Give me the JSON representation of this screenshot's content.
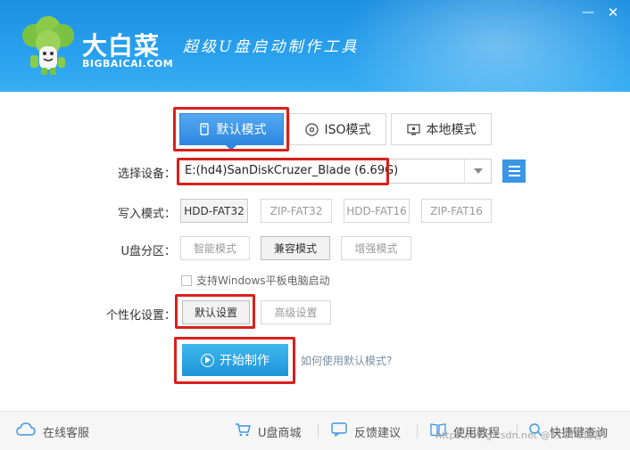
{
  "brand": {
    "name": "大白菜",
    "domain": "BIGBAICAI.COM",
    "slogan": "超级U盘启动制作工具"
  },
  "window": {
    "minimize": "—",
    "close": "✕"
  },
  "tabs": [
    {
      "label": "默认模式",
      "icon": "usb-icon",
      "active": true
    },
    {
      "label": "ISO模式",
      "icon": "disc-icon",
      "active": false
    },
    {
      "label": "本地模式",
      "icon": "monitor-icon",
      "active": false
    }
  ],
  "device": {
    "label": "选择设备：",
    "value": "E:(hd4)SanDiskCruzer_Blade (6.69G)"
  },
  "write_mode": {
    "label": "写入模式：",
    "options": [
      "HDD-FAT32",
      "ZIP-FAT32",
      "HDD-FAT16",
      "ZIP-FAT16"
    ],
    "selected": "HDD-FAT32"
  },
  "partition": {
    "label": "U盘分区：",
    "options": [
      "智能模式",
      "兼容模式",
      "增强模式"
    ],
    "selected": "兼容模式"
  },
  "tablet_boot": {
    "label": "支持Windows平板电脑启动",
    "checked": false
  },
  "personalize": {
    "label": "个性化设置：",
    "options": [
      "默认设置",
      "高级设置"
    ],
    "selected": "默认设置"
  },
  "start": {
    "label": "开始制作",
    "help": "如何使用默认模式?"
  },
  "footer": {
    "items": [
      {
        "label": "在线客服",
        "icon": "cloud-icon"
      },
      {
        "label": "U盘商城",
        "icon": "cart-icon"
      },
      {
        "label": "反馈建议",
        "icon": "feedback-icon"
      },
      {
        "label": "使用教程",
        "icon": "book-icon"
      },
      {
        "label": "快捷键查询",
        "icon": "search-icon"
      }
    ]
  },
  "watermark": "https://blog.csdn.net @51CTO博客",
  "colors": {
    "header": "#2aa1ee",
    "accent": "#2f86e0",
    "highlight": "#d9201b",
    "start": "#1e94d8"
  }
}
